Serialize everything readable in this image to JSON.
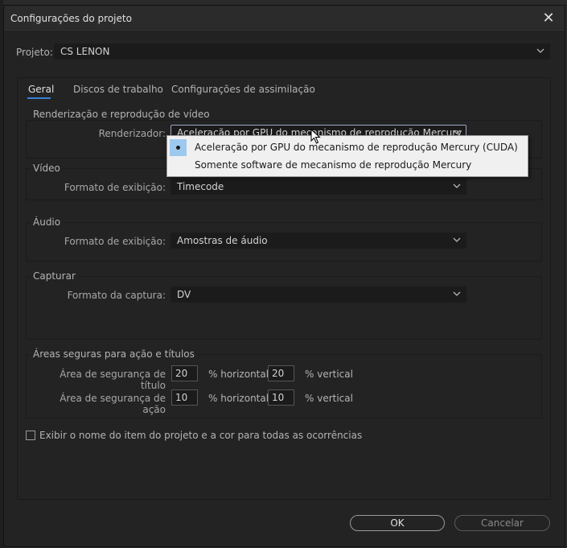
{
  "dialog": {
    "title": "Configurações do projeto",
    "project_label": "Projeto:",
    "project_value": "CS LENON"
  },
  "tabs": [
    {
      "label": "Geral",
      "active": true
    },
    {
      "label": "Discos de trabalho",
      "active": false
    },
    {
      "label": "Configurações de assimilação",
      "active": false
    }
  ],
  "render": {
    "group_title": "Renderização e reprodução de vídeo",
    "renderer_label": "Renderizador:",
    "renderer_value": "Aceleração por GPU do mecanismo de reprodução Mercury (CUDA)",
    "options": [
      "Aceleração por GPU do mecanismo de reprodução Mercury (CUDA)",
      "Somente software de mecanismo de reprodução Mercury"
    ]
  },
  "video": {
    "group_title": "Vídeo",
    "format_label": "Formato de exibição:",
    "format_value": "Timecode"
  },
  "audio": {
    "group_title": "Áudio",
    "format_label": "Formato de exibição:",
    "format_value": "Amostras de áudio"
  },
  "capture": {
    "group_title": "Capturar",
    "format_label": "Formato da captura:",
    "format_value": "DV"
  },
  "safe": {
    "group_title": "Áreas seguras para ação e títulos",
    "title_label": "Área de segurança de título",
    "title_h": "20",
    "title_v": "20",
    "action_label": "Área de segurança de ação",
    "action_h": "10",
    "action_v": "10",
    "horizontal_label": "% horizontal",
    "vertical_label": "% vertical"
  },
  "checkbox_label": "Exibir o nome do item do projeto e a cor para todas as ocorrências",
  "buttons": {
    "ok": "OK",
    "cancel": "Cancelar"
  },
  "colors": {
    "accent": "#3a7fd5",
    "dialog_bg": "#232323",
    "dropdown_bg": "#f0f0f0",
    "selected_option": "#9ec9ef"
  }
}
